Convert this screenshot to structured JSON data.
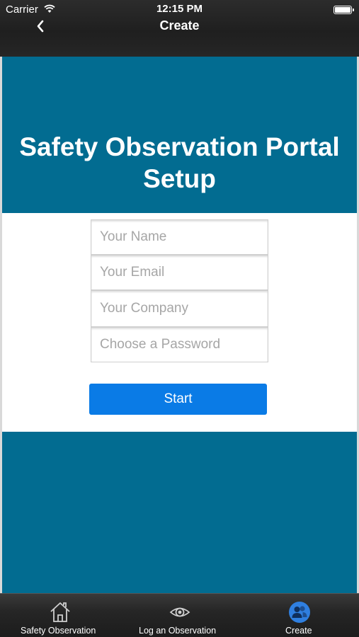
{
  "status_bar": {
    "carrier": "Carrier",
    "time": "12:15 PM"
  },
  "nav": {
    "title": "Create",
    "back_icon": "chevron-left-icon"
  },
  "hero": {
    "title": "Safety Observation Portal Setup"
  },
  "form": {
    "name_placeholder": "Your Name",
    "email_placeholder": "Your Email",
    "company_placeholder": "Your Company",
    "password_placeholder": "Choose a Password",
    "start_label": "Start"
  },
  "tabs": [
    {
      "label": "Safety Observation",
      "icon": "home-icon"
    },
    {
      "label": "Log an Observation",
      "icon": "eye-icon"
    },
    {
      "label": "Create",
      "icon": "users-icon",
      "active": true
    }
  ],
  "colors": {
    "brand_blue": "#026c91",
    "button_blue": "#0a7be6",
    "active_tab": "#2f7fe0"
  }
}
